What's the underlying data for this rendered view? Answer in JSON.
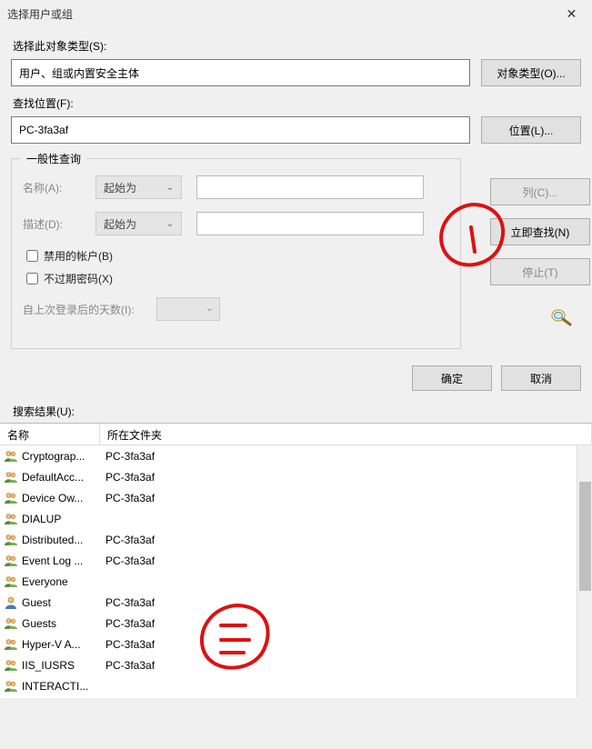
{
  "window": {
    "title": "选择用户或组"
  },
  "object_type": {
    "label": "选择此对象类型(S):",
    "value": "用户、组或内置安全主体",
    "button": "对象类型(O)..."
  },
  "location": {
    "label": "查找位置(F):",
    "value": "PC-3fa3af",
    "button": "位置(L)..."
  },
  "query": {
    "legend": "一般性查询",
    "name_label": "名称(A):",
    "name_mode": "起始为",
    "desc_label": "描述(D):",
    "desc_mode": "起始为",
    "cb_disabled": "禁用的帐户(B)",
    "cb_noexpire": "不过期密码(X)",
    "days_label": "自上次登录后的天数(I):",
    "btn_columns": "列(C)...",
    "btn_findnow": "立即查找(N)",
    "btn_stop": "停止(T)"
  },
  "dialog": {
    "ok": "确定",
    "cancel": "取消"
  },
  "results": {
    "label": "搜索结果(U):",
    "col_name": "名称",
    "col_folder": "所在文件夹",
    "rows": [
      {
        "name": "Cryptograp...",
        "folder": "PC-3fa3af",
        "icon": "group"
      },
      {
        "name": "DefaultAcc...",
        "folder": "PC-3fa3af",
        "icon": "group"
      },
      {
        "name": "Device Ow...",
        "folder": "PC-3fa3af",
        "icon": "group"
      },
      {
        "name": "DIALUP",
        "folder": "",
        "icon": "group"
      },
      {
        "name": "Distributed...",
        "folder": "PC-3fa3af",
        "icon": "group"
      },
      {
        "name": "Event Log ...",
        "folder": "PC-3fa3af",
        "icon": "group"
      },
      {
        "name": "Everyone",
        "folder": "",
        "icon": "group"
      },
      {
        "name": "Guest",
        "folder": "PC-3fa3af",
        "icon": "user"
      },
      {
        "name": "Guests",
        "folder": "PC-3fa3af",
        "icon": "group"
      },
      {
        "name": "Hyper-V A...",
        "folder": "PC-3fa3af",
        "icon": "group"
      },
      {
        "name": "IIS_IUSRS",
        "folder": "PC-3fa3af",
        "icon": "group"
      },
      {
        "name": "INTERACTI...",
        "folder": "",
        "icon": "group"
      }
    ]
  },
  "annotations": {
    "mark1": "1",
    "mark2": "2"
  }
}
